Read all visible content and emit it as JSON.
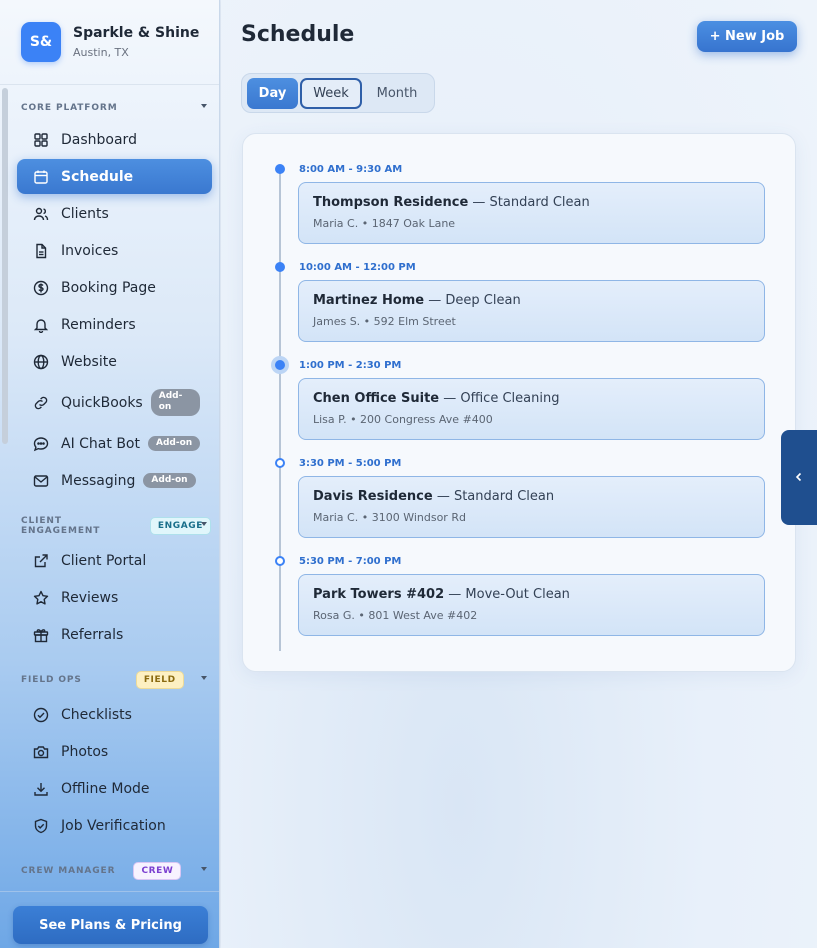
{
  "brand": {
    "initials": "S&",
    "name": "Sparkle & Shine",
    "location": "Austin, TX"
  },
  "sidebar": {
    "sections": [
      {
        "label": "CORE PLATFORM",
        "badge": ""
      },
      {
        "label": "CLIENT ENGAGEMENT",
        "badge": "ENGAGE"
      },
      {
        "label": "FIELD OPS",
        "badge": "FIELD"
      },
      {
        "label": "CREW MANAGER",
        "badge": "CREW"
      }
    ],
    "items": [
      {
        "label": "Dashboard",
        "icon": "grid-icon"
      },
      {
        "label": "Schedule",
        "icon": "calendar-icon",
        "active": true
      },
      {
        "label": "Clients",
        "icon": "users-icon"
      },
      {
        "label": "Invoices",
        "icon": "file-icon"
      },
      {
        "label": "Booking Page",
        "icon": "dollar-icon"
      },
      {
        "label": "Reminders",
        "icon": "bell-icon"
      },
      {
        "label": "Website",
        "icon": "globe-icon"
      },
      {
        "label": "QuickBooks",
        "icon": "link-icon",
        "addon": "Add-on"
      },
      {
        "label": "AI Chat Bot",
        "icon": "chat-icon",
        "addon": "Add-on"
      },
      {
        "label": "Messaging",
        "icon": "mail-icon",
        "addon": "Add-on"
      },
      {
        "label": "Client Portal",
        "icon": "external-link-icon"
      },
      {
        "label": "Reviews",
        "icon": "star-icon"
      },
      {
        "label": "Referrals",
        "icon": "gift-icon"
      },
      {
        "label": "Checklists",
        "icon": "check-circle-icon"
      },
      {
        "label": "Photos",
        "icon": "camera-icon"
      },
      {
        "label": "Offline Mode",
        "icon": "download-icon"
      },
      {
        "label": "Job Verification",
        "icon": "shield-check-icon"
      }
    ],
    "pricing_button": "See Plans & Pricing"
  },
  "main": {
    "title": "Schedule",
    "new_job_button": "+ New Job",
    "view_tabs": [
      "Day",
      "Week",
      "Month"
    ],
    "selected_view": "Day",
    "jobs": [
      {
        "time": "8:00 AM - 9:30 AM",
        "client": "Thompson Residence",
        "service": "— Standard Clean",
        "details": "Maria C. • 1847 Oak Lane",
        "marker": "filled"
      },
      {
        "time": "10:00 AM - 12:00 PM",
        "client": "Martinez Home",
        "service": "— Deep Clean",
        "details": "James S. • 592 Elm Street",
        "marker": "filled"
      },
      {
        "time": "1:00 PM - 2:30 PM",
        "client": "Chen Office Suite",
        "service": "— Office Cleaning",
        "details": "Lisa P. • 200 Congress Ave #400",
        "marker": "current"
      },
      {
        "time": "3:30 PM - 5:00 PM",
        "client": "Davis Residence",
        "service": "— Standard Clean",
        "details": "Maria C. • 3100 Windsor Rd",
        "marker": "upcoming"
      },
      {
        "time": "5:30 PM - 7:00 PM",
        "client": "Park Towers #402",
        "service": "— Move-Out Clean",
        "details": "Rosa G. • 801 West Ave #402",
        "marker": "upcoming"
      }
    ]
  },
  "colors": {
    "accent": "#3b82f6",
    "sidebar_active": "#3a78d0",
    "collapse_tab": "#1f4f8f"
  }
}
